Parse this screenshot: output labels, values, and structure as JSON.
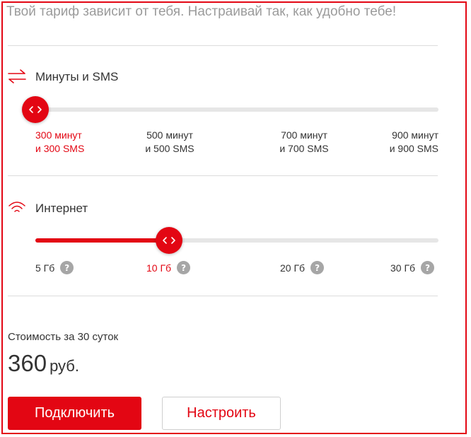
{
  "headline": "Твой тариф зависит от тебя. Настраивай так, как удобно тебе!",
  "minutes_section": {
    "title": "Минуты и SMS",
    "icon": "swap-arrows-icon",
    "selected_index": 0,
    "options": [
      {
        "line1": "300 минут",
        "line2": "и 300 SMS"
      },
      {
        "line1": "500 минут",
        "line2": "и 500 SMS"
      },
      {
        "line1": "700 минут",
        "line2": "и 700 SMS"
      },
      {
        "line1": "900 минут",
        "line2": "и 900 SMS"
      }
    ]
  },
  "internet_section": {
    "title": "Интернет",
    "icon": "wifi-icon",
    "selected_index": 1,
    "options": [
      {
        "label": "5 Гб",
        "help": "?"
      },
      {
        "label": "10 Гб",
        "help": "?"
      },
      {
        "label": "20 Гб",
        "help": "?"
      },
      {
        "label": "30 Гб",
        "help": "?"
      }
    ]
  },
  "cost": {
    "label": "Стоимость за 30 суток",
    "amount": "360",
    "currency": "руб."
  },
  "buttons": {
    "connect": "Подключить",
    "configure": "Настроить"
  },
  "colors": {
    "accent": "#e30613",
    "muted_text": "#9b9b9b",
    "track": "#e6e6e6",
    "help_icon": "#a6a6a6"
  }
}
